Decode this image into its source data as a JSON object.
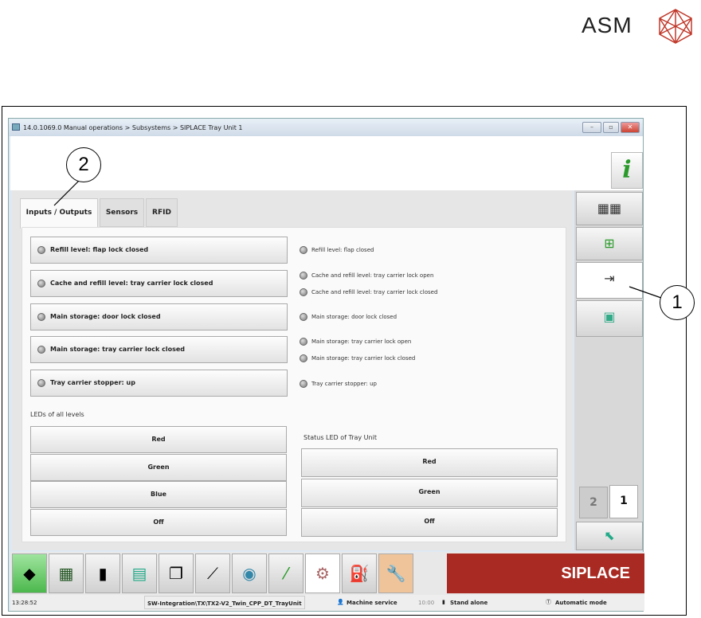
{
  "logo": {
    "text": "ASM"
  },
  "window": {
    "title": "14.0.1069.0 Manual operations > Subsystems > SIPLACE Tray Unit 1",
    "minimize": "–",
    "maximize": "▫",
    "close": "✕"
  },
  "info_button": "i",
  "tabs": [
    {
      "label": "Inputs / Outputs"
    },
    {
      "label": "Sensors"
    },
    {
      "label": "RFID"
    }
  ],
  "io_buttons": [
    {
      "label": "Refill level: flap lock closed"
    },
    {
      "label": "Cache and refill level: tray carrier lock closed"
    },
    {
      "label": "Main storage: door lock closed"
    },
    {
      "label": "Main storage: tray carrier lock closed"
    },
    {
      "label": "Tray carrier stopper: up"
    }
  ],
  "status_items": [
    {
      "label": "Refill level: flap closed"
    },
    {
      "label": "Cache and refill level: tray carrier lock open"
    },
    {
      "label": "Cache and refill level: tray carrier lock closed"
    },
    {
      "label": "Main storage: door lock closed"
    },
    {
      "label": "Main storage: tray carrier lock open"
    },
    {
      "label": "Main storage: tray carrier lock closed"
    },
    {
      "label": "Tray carrier stopper: up"
    }
  ],
  "leds_all": {
    "label": "LEDs of all levels",
    "buttons": [
      "Red",
      "Green",
      "Blue",
      "Off"
    ]
  },
  "leds_tray": {
    "label": "Status LED of Tray Unit",
    "buttons": [
      "Red",
      "Green",
      "Off"
    ]
  },
  "pages": {
    "page2": "2",
    "page1": "1"
  },
  "taskbar": {
    "brand": "SIPLACE"
  },
  "statusbar": {
    "time": "13:28:52",
    "path": "SW-Integration\\TX\\TX2-V2_Twin_CPP_DT_TrayUnit",
    "user": "Machine service",
    "clock": "10:00",
    "mode1": "Stand alone",
    "mode2": "Automatic mode"
  },
  "callouts": {
    "one": "1",
    "two": "2"
  },
  "colors": {
    "brand_red": "#a92a22",
    "accent_green": "#2a9a2a"
  }
}
